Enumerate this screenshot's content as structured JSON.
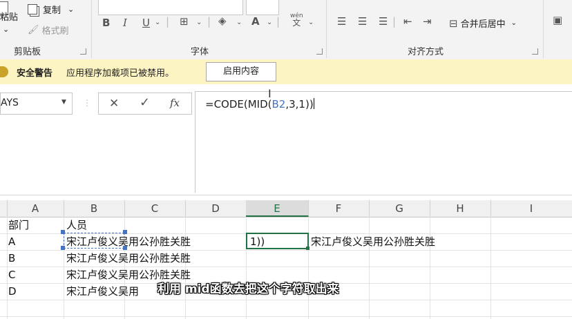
{
  "ribbon": {
    "clipboard": {
      "paste_label": "粘贴",
      "copy_label": "复制",
      "format_painter_label": "格式刷",
      "group_label": "剪贴板"
    },
    "font": {
      "bold": "B",
      "italic": "I",
      "underline": "U",
      "phonetic_top": "wén",
      "phonetic_bottom": "文",
      "group_label": "字体"
    },
    "alignment": {
      "merge_center_label": "合并后居中",
      "group_label": "对齐方式"
    }
  },
  "security_bar": {
    "title": "安全警告",
    "message": "应用程序加载项已被禁用。",
    "enable_button": "启用内容"
  },
  "formula_bar": {
    "name_box": "AYS",
    "cancel_glyph": "✕",
    "confirm_glyph": "✓",
    "fx_label": "fx",
    "formula_prefix": "=CODE(MID(",
    "formula_ref": "B2",
    "formula_suffix": ",3,1))"
  },
  "grid": {
    "columns": [
      "A",
      "B",
      "C",
      "D",
      "E",
      "F",
      "G",
      "H",
      "I"
    ],
    "selected_column": "E",
    "cells": {
      "A1": "部门",
      "B1": "人员",
      "A2": "A",
      "B2": "宋江卢俊义吴用公孙胜关胜",
      "E2": "1))",
      "F2": "宋江卢俊义吴用公孙胜关胜",
      "A3": "B",
      "B3": "宋江卢俊义吴用公孙胜关胜",
      "A4": "C",
      "B4": "宋江卢俊义吴用公孙胜关胜",
      "A5": "D",
      "B5": "宋江卢俊义吴用"
    }
  },
  "subtitle": "利用 mid函数去把这个字符取出来",
  "colors": {
    "security_bar": "#fdf4c4",
    "selection_green": "#217346",
    "reference_blue": "#4472c4"
  }
}
